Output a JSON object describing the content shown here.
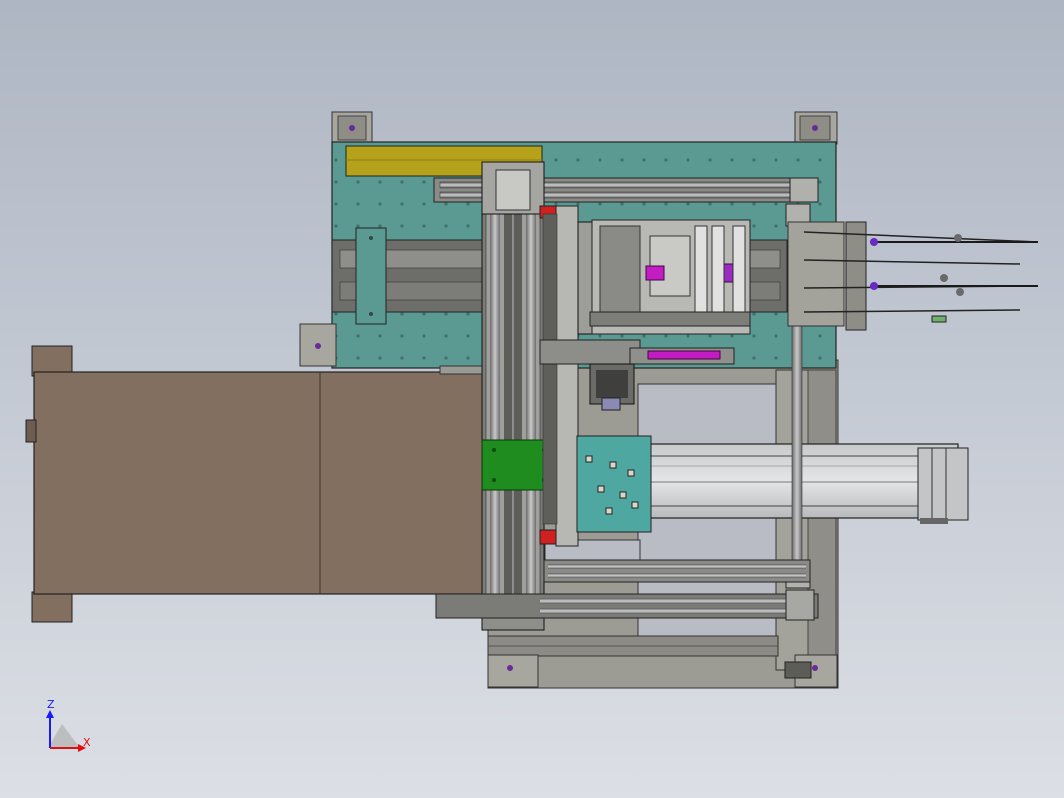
{
  "view": {
    "type": "cad-assembly-top-view",
    "background": [
      "#aeb6c3",
      "#dcdfe5"
    ]
  },
  "triad": {
    "z_label": "Z",
    "x_label": "X",
    "z_color": "#1a1aff",
    "x_color": "#e01010",
    "origin_color": "#888888"
  },
  "colors": {
    "frame_gray": "#9c9b94",
    "frame_dark": "#6f6e68",
    "teal_plate": "#5a9a93",
    "olive_cover": "#b5a21a",
    "brown_box": "#826f60",
    "green_carriage": "#1f8c1f",
    "red_stop": "#d02020",
    "magenta_cylinder": "#c21cc2",
    "violet_bolt": "#6a2a9a",
    "conveyor_light": "#d6d7d8",
    "teal_table": "#4fa7a1"
  }
}
